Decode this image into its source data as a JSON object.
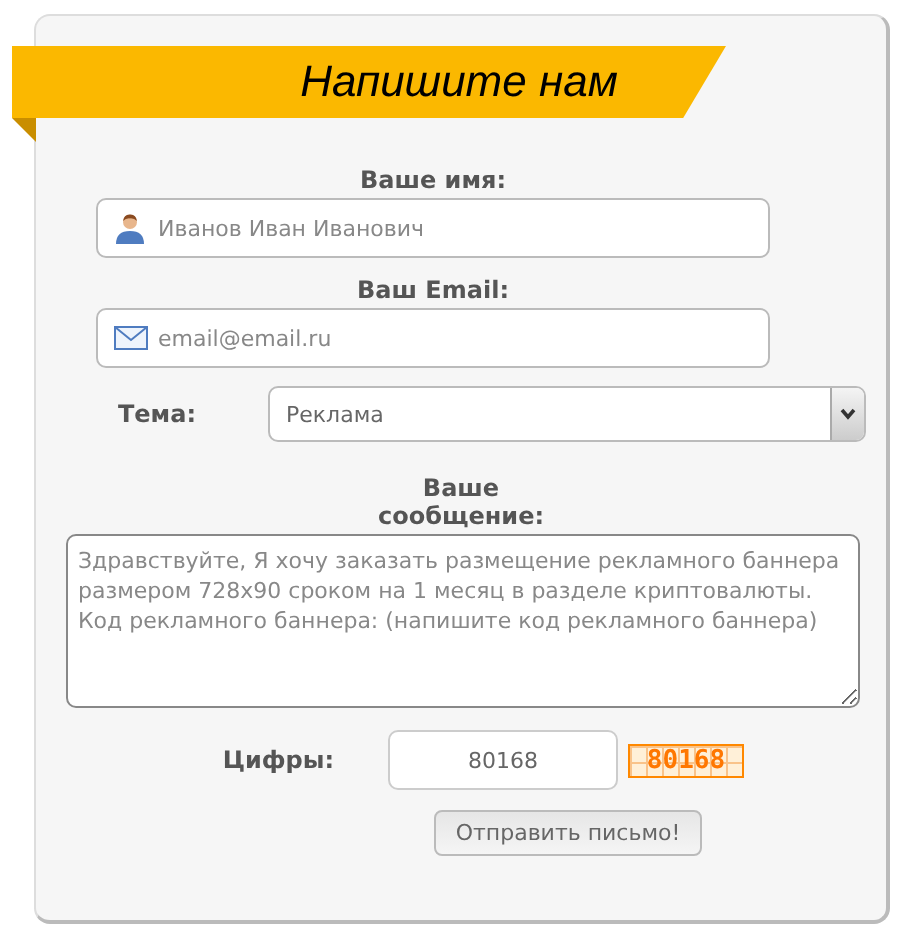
{
  "header": {
    "title": "Напишите нам"
  },
  "fields": [
    {
      "kind": "person",
      "label": "Ваше имя:",
      "placeholder": "Иванов Иван Иванович"
    },
    {
      "kind": "email",
      "label": "Ваш Email:",
      "placeholder": "email@email.ru"
    }
  ],
  "topic": {
    "label": "Тема:",
    "value": "Реклама"
  },
  "message": {
    "label": "Ваше сообщение:",
    "placeholder": "Здравствуйте, Я хочу заказать размещение рекламного баннера размером 728x90 сроком на 1 месяц в разделе криптовалюты.\nКод рекламного баннера: (напишите код рекламного баннера)"
  },
  "captcha": {
    "label": "Цифры:",
    "value": "80168",
    "code": "80168"
  },
  "submit": {
    "label": "Отправить письмо!"
  }
}
